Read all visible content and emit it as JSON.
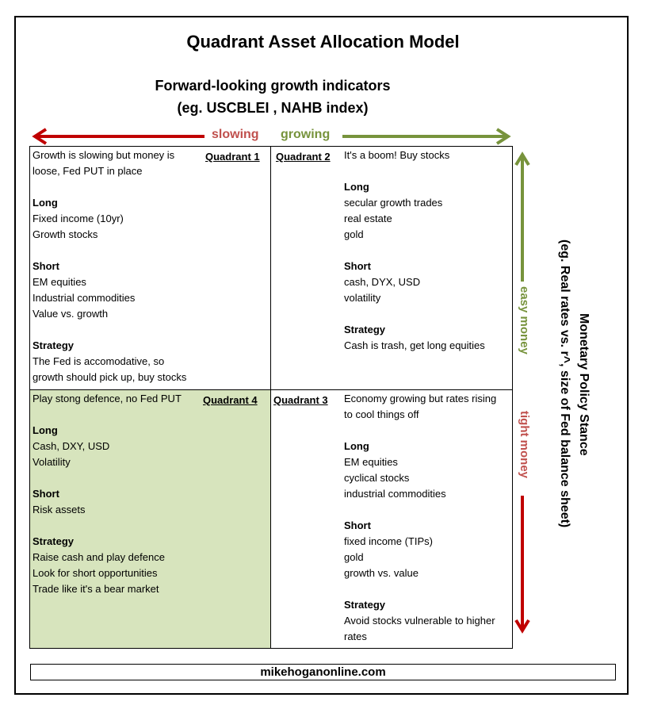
{
  "title": "Quadrant Asset Allocation Model",
  "x_axis": {
    "heading_line1": "Forward-looking growth indicators",
    "heading_line2": "(eg. USCBLEI , NAHB index)",
    "left_label": "slowing",
    "right_label": "growing"
  },
  "y_axis": {
    "heading_line1": "Monetary Policy Stance",
    "heading_line2": "(eg. Real rates vs. r^, size of Fed balance sheet)",
    "top_label": "easy money",
    "bottom_label": "tight money"
  },
  "colors": {
    "red_arrow": "#c00000",
    "red_text": "#c0504d",
    "green_arrow": "#77933c",
    "green_text": "#77933c",
    "quadrant4_fill": "#d7e4bd"
  },
  "quadrants": {
    "q1": {
      "label": "Quadrant 1",
      "summary": [
        "Growth is slowing but money is",
        "loose, Fed PUT in place"
      ],
      "long_heading": "Long",
      "long": [
        "Fixed income (10yr)",
        "Growth stocks"
      ],
      "short_heading": "Short",
      "short": [
        "EM equities",
        "Industrial commodities",
        "Value vs. growth"
      ],
      "strategy_heading": "Strategy",
      "strategy": [
        "The Fed is accomodative, so",
        "growth should pick up, buy stocks"
      ]
    },
    "q2": {
      "label": "Quadrant 2",
      "summary": [
        "It's a boom!  Buy stocks"
      ],
      "long_heading": "Long",
      "long": [
        "secular growth trades",
        "real estate",
        "gold"
      ],
      "short_heading": "Short",
      "short": [
        "cash, DYX, USD",
        "volatility"
      ],
      "strategy_heading": "Strategy",
      "strategy": [
        "Cash is trash, get long equities"
      ]
    },
    "q3": {
      "label": "Quadrant 3",
      "summary": [
        "Economy growing but rates rising",
        "to cool things off"
      ],
      "long_heading": "Long",
      "long": [
        "EM equities",
        "cyclical stocks",
        "industrial commodities"
      ],
      "short_heading": "Short",
      "short": [
        "fixed income (TIPs)",
        "gold",
        "growth vs. value"
      ],
      "strategy_heading": "Strategy",
      "strategy": [
        "Avoid stocks vulnerable to higher",
        "rates"
      ]
    },
    "q4": {
      "label": "Quadrant 4",
      "summary": [
        "Play stong defence, no Fed PUT"
      ],
      "long_heading": "Long",
      "long": [
        "Cash, DXY, USD",
        "Volatility"
      ],
      "short_heading": "Short",
      "short": [
        "Risk assets"
      ],
      "strategy_heading": "Strategy",
      "strategy": [
        "Raise cash and play defence",
        "Look for short opportunities",
        "Trade like it's a bear market"
      ]
    }
  },
  "footer": "mikehoganonline.com"
}
